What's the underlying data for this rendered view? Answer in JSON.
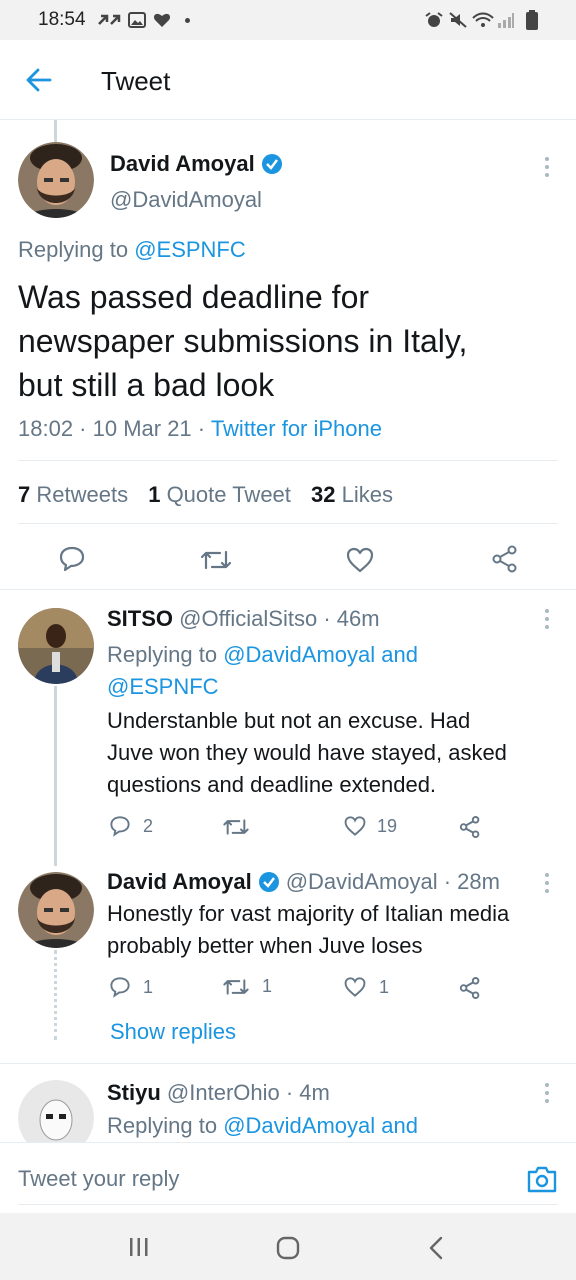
{
  "status_bar": {
    "time": "18:54"
  },
  "header": {
    "title": "Tweet"
  },
  "main_tweet": {
    "name": "David Amoyal",
    "handle": "@DavidAmoyal",
    "replying_prefix": "Replying to ",
    "replying_to": "@ESPNFC",
    "text_line1": "Was passed deadline for",
    "text_line2": "newspaper submissions in Italy,",
    "text_line3": "but still a bad look",
    "time": "18:02 · 10 Mar 21 · ",
    "source": "Twitter for iPhone",
    "retweets_count": "7",
    "retweets_label": " Retweets",
    "quotes_count": "1",
    "quotes_label": " Quote Tweet",
    "likes_count": "32",
    "likes_label": " Likes"
  },
  "replies": [
    {
      "name": "SITSO",
      "handle_time": " @OfficialSitso · 46m",
      "replying_prefix": "Replying to ",
      "replying_to_line1": "@DavidAmoyal and",
      "replying_to_line2": "@ESPNFC",
      "text_line1": "Understanble but not an excuse. Had",
      "text_line2": "Juve won they would have stayed, asked",
      "text_line3": "questions and deadline extended.",
      "reply_count": "2",
      "retweet_count": "",
      "like_count": "19"
    },
    {
      "name": "David Amoyal",
      "handle_time": "@DavidAmoyal · 28m",
      "text_line1": "Honestly for vast majority of Italian media",
      "text_line2": "probably better when Juve loses",
      "reply_count": "1",
      "retweet_count": "1",
      "like_count": "1",
      "show_replies": "Show replies"
    },
    {
      "name": "Stiyu",
      "handle_time": " @InterOhio · 4m",
      "replying_prefix": "Replying to ",
      "replying_to_line1": "@DavidAmoyal and"
    }
  ],
  "reply_bar": {
    "placeholder": "Tweet your reply"
  },
  "colors": {
    "accent": "#1b95e0",
    "muted": "#657786",
    "text": "#14171a"
  }
}
